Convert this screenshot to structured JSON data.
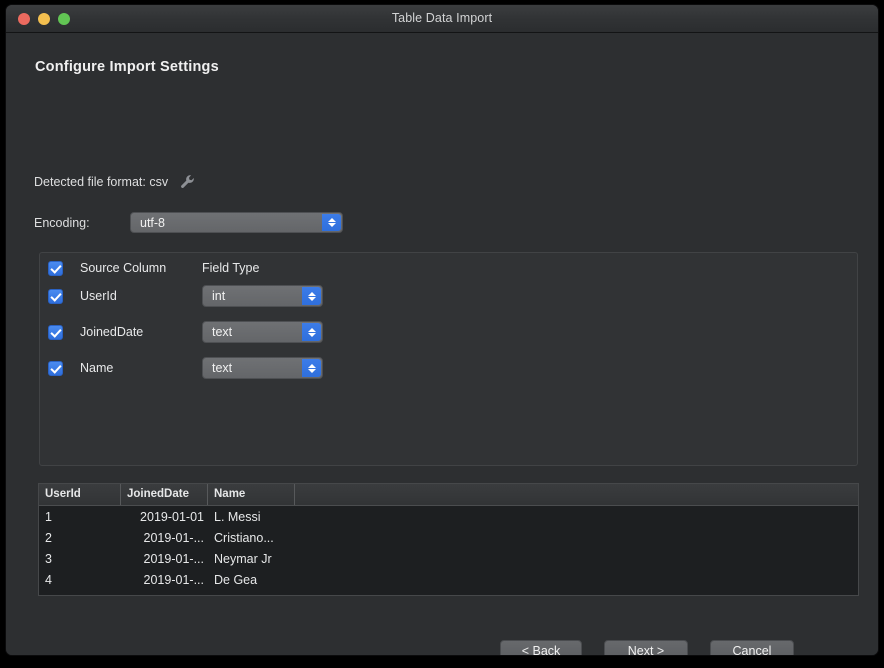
{
  "window": {
    "title": "Table Data Import",
    "traffic_lights": [
      {
        "name": "close-button",
        "color": "#ec6a5f"
      },
      {
        "name": "minimize-button",
        "color": "#f3bf4f"
      },
      {
        "name": "zoom-button",
        "color": "#62c554"
      }
    ]
  },
  "page": {
    "heading": "Configure Import Settings"
  },
  "detected": {
    "label": "Detected file format: csv",
    "icon": "wrench-icon"
  },
  "encoding": {
    "label": "Encoding:",
    "value": "utf-8"
  },
  "columns": {
    "header": {
      "source_column": "Source Column",
      "field_type": "Field Type"
    },
    "rows": [
      {
        "checked": true,
        "name": "UserId",
        "type": "int"
      },
      {
        "checked": true,
        "name": "JoinedDate",
        "type": "text"
      },
      {
        "checked": true,
        "name": "Name",
        "type": "text"
      }
    ]
  },
  "preview": {
    "headers": [
      "UserId",
      "JoinedDate",
      "Name",
      ""
    ],
    "rows": [
      [
        "1",
        "2019-01-01",
        "L. Messi",
        ""
      ],
      [
        "2",
        "2019-01-...",
        "Cristiano...",
        ""
      ],
      [
        "3",
        "2019-01-...",
        "Neymar Jr",
        ""
      ],
      [
        "4",
        "2019-01-...",
        "De Gea",
        ""
      ]
    ]
  },
  "footer": {
    "back": "< Back",
    "next": "Next >",
    "cancel": "Cancel"
  },
  "colors": {
    "accent_blue": "#2f6fdc",
    "window_bg": "#2d2f31",
    "panel_bg": "#313335",
    "table_bg": "#1d1f21"
  }
}
